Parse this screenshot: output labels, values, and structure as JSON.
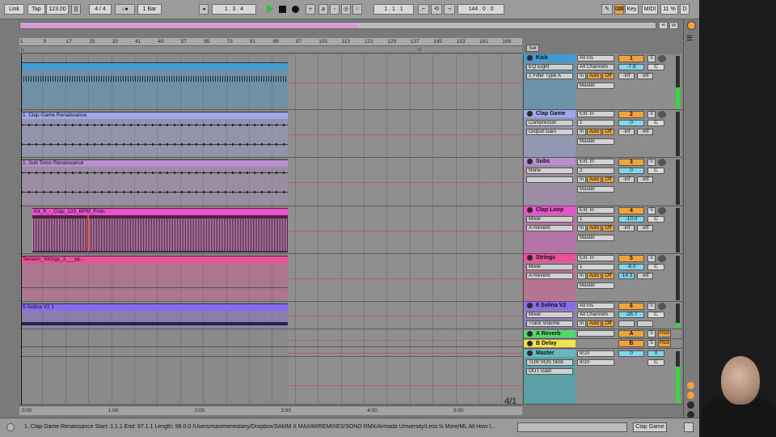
{
  "toolbar": {
    "link": "Link",
    "tap": "Tap",
    "tempo": "123.00",
    "sig": "4 / 4",
    "metro_icon": "○●",
    "quant": "1 Bar",
    "position": "1 .  3 .  4",
    "loop_start": "1 .  1 .  1",
    "loop_len": "144 .  0 .  0",
    "key": "Key",
    "midi": "MIDI",
    "cpu": "11 %",
    "d": "D"
  },
  "overview": {
    "h": "H",
    "w": "W"
  },
  "ruler_bars": [
    "1",
    "9",
    "17",
    "25",
    "33",
    "41",
    "49",
    "57",
    "65",
    "73",
    "81",
    "89",
    "97",
    "105",
    "113",
    "121",
    "129",
    "137",
    "145",
    "153",
    "161",
    "169"
  ],
  "time_labels": [
    "0:00",
    "1:00",
    "2:00",
    "3:00",
    "4:00",
    "5:00"
  ],
  "arrangement": {
    "quantize_display": "4/1",
    "clips": [
      {
        "name": "",
        "color": "#3d9bd6"
      },
      {
        "name": "1. Clap Game Renaissance",
        "color": "#9ea9ec"
      },
      {
        "name": "1. Sub Toms Renaissance",
        "color": "#b98fd0"
      },
      {
        "name": "Kit_8_-_Clap_123_BPM_Fmin",
        "color": "#f04fd0"
      },
      {
        "name": "Tension_Strings_2___pp...",
        "color": "#ef4f9a"
      },
      {
        "name": "5-Solina V2 1",
        "color": "#8a6af0"
      }
    ]
  },
  "mixer": {
    "set_label": "Set",
    "tracks": [
      {
        "name": "Kick",
        "color": "#3d9bd6",
        "dev1": "EQ Eight",
        "dev2": "1 Filter Type A",
        "input": "All Ins",
        "channel": "All Channels",
        "output": "Master",
        "num": "1",
        "vol": "-7.8",
        "pan": "C",
        "peak1": "-inf",
        "peak2": "-inf"
      },
      {
        "name": "Clap Game",
        "color": "#9ea9ec",
        "dev1": "Compressor",
        "dev2": "Output Gain",
        "input": "Ext. In",
        "channel": "1",
        "output": "Master",
        "num": "2",
        "vol": "0",
        "pan": "C",
        "peak1": "-inf",
        "peak2": "-inf"
      },
      {
        "name": "Subs",
        "color": "#b98fd0",
        "dev1": "None",
        "dev2": "",
        "input": "Ext. In",
        "channel": "2",
        "output": "Master",
        "num": "3",
        "vol": "0",
        "pan": "C",
        "peak1": "-inf",
        "peak2": "-inf"
      },
      {
        "name": "Clap Loop",
        "color": "#f04fd0",
        "dev1": "Mixer",
        "dev2": "A-Reverb",
        "input": "Ext. In",
        "channel": "1",
        "output": "Master",
        "num": "4",
        "vol": "-10.0",
        "pan": "C",
        "peak1": "-inf",
        "peak2": "-inf"
      },
      {
        "name": "Strings",
        "color": "#ef4f9a",
        "dev1": "Mixer",
        "dev2": "A-Reverb",
        "input": "Ext. In",
        "channel": "1",
        "output": "Master",
        "num": "5",
        "vol": "-8.0",
        "pan": "C",
        "peak1": "-14.3",
        "peak2": "-inf"
      },
      {
        "name": "6 Solina V2",
        "color": "#8a6af0",
        "dev1": "Mixer",
        "dev2": "Track Volume",
        "input": "All Ins",
        "channel": "All Channels",
        "output": "",
        "num": "6",
        "vol": "-26.7",
        "pan": "C",
        "peak1": "",
        "peak2": ""
      }
    ],
    "returns": [
      {
        "name": "A Reverb",
        "color": "#4fd96a",
        "num": "A",
        "post": "Post"
      },
      {
        "name": "B Delay",
        "color": "#f1e34a",
        "num": "B",
        "post": "Post"
      }
    ],
    "master": {
      "name": "Master",
      "dev1": "TDR VOS Slick",
      "dev2": "OUT Gain",
      "input": "9/10",
      "output": "9/10",
      "num": "0",
      "vol": "0",
      "pan": "C"
    },
    "monitor": {
      "in": "In",
      "auto": "Auto",
      "off": "Off"
    },
    "solo": "S"
  },
  "status": {
    "text": "1. Clap Game Renaissance   Start: 1.1.1  End: 97.1.1  Length: 96.0.0  /Users/maximeneslany/Dropbox/SAMM X MAXIM/REMIXES/SONO RMX/Armada University/Less Is More/ML All How I...",
    "track": "Clap Game"
  },
  "colors": {
    "accent": "#f1a33a",
    "play": "#2fbf3a",
    "volume": "#7fd8ef",
    "meter": "#37d43e"
  }
}
